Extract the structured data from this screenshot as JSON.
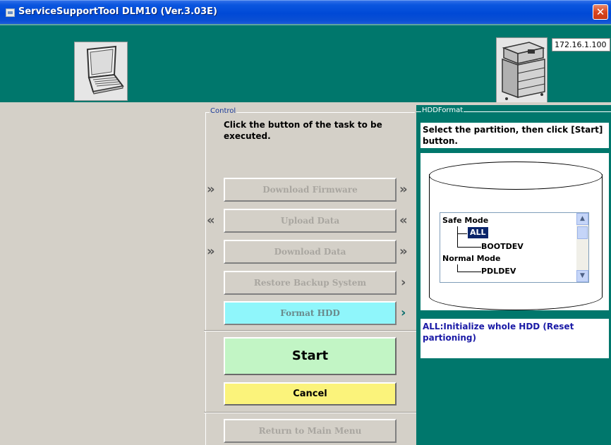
{
  "window": {
    "title": "ServiceSupportTool DLM10 (Ver.3.03E)",
    "close_glyph": "✕"
  },
  "header": {
    "ip_address": "172.16.1.100",
    "laptop_icon": "laptop-icon",
    "printer_icon": "printer-icon",
    "band_color": "#00776c"
  },
  "control": {
    "legend": "Control",
    "instruction": "Click the button of the task to be executed.",
    "tasks": [
      {
        "label": "Download Firmware",
        "left_glyph": "»",
        "right_glyph": "»",
        "enabled": false
      },
      {
        "label": "Upload Data",
        "left_glyph": "«",
        "right_glyph": "«",
        "enabled": false
      },
      {
        "label": "Download Data",
        "left_glyph": "»",
        "right_glyph": "»",
        "enabled": false
      },
      {
        "label": "Restore Backup System",
        "right_glyph": "›",
        "enabled": false
      },
      {
        "label": "Format HDD",
        "right_glyph": "›",
        "selected": true
      }
    ],
    "start_label": "Start",
    "cancel_label": "Cancel",
    "return_label": "Return to Main Menu",
    "colors": {
      "start": "#c2f5c5",
      "cancel": "#fbf37b",
      "selected_task": "#8ff6fb"
    }
  },
  "hdd": {
    "legend": "HDDFormat",
    "instruction": "Select the partition, then click [Start] button.",
    "tree": [
      {
        "label": "Safe Mode",
        "level": 0
      },
      {
        "label": "ALL",
        "level": 1,
        "selected": true
      },
      {
        "label": "BOOTDEV",
        "level": 1
      },
      {
        "label": "Normal Mode",
        "level": 0
      },
      {
        "label": "PDLDEV",
        "level": 1
      }
    ],
    "description": "ALL:Initialize whole HDD (Reset partioning)"
  }
}
